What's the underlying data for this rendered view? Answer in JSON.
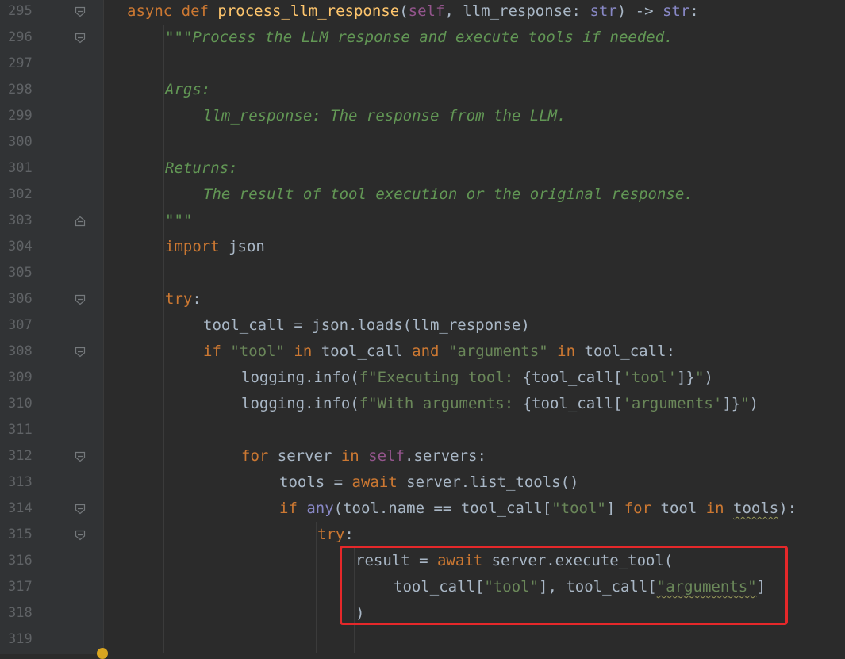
{
  "editor": {
    "lines": [
      {
        "num": "295",
        "indent": 0,
        "fold": "open",
        "tokens": [
          {
            "t": "async ",
            "c": "kw"
          },
          {
            "t": "def ",
            "c": "kw"
          },
          {
            "t": "process_llm_response",
            "c": "fn"
          },
          {
            "t": "(",
            "c": "pl"
          },
          {
            "t": "self",
            "c": "sf"
          },
          {
            "t": ", llm_response: ",
            "c": "pl"
          },
          {
            "t": "str",
            "c": "bi"
          },
          {
            "t": ") -> ",
            "c": "pl"
          },
          {
            "t": "str",
            "c": "bi"
          },
          {
            "t": ":",
            "c": "pl"
          }
        ]
      },
      {
        "num": "296",
        "indent": 1,
        "fold": "open",
        "tokens": [
          {
            "t": "\"\"\"Process the LLM response and execute tools if needed.",
            "c": "doc"
          }
        ]
      },
      {
        "num": "297",
        "indent": 1,
        "fold": "",
        "tokens": []
      },
      {
        "num": "298",
        "indent": 1,
        "fold": "",
        "tokens": [
          {
            "t": "Args:",
            "c": "doc"
          }
        ]
      },
      {
        "num": "299",
        "indent": 2,
        "fold": "",
        "tokens": [
          {
            "t": "llm_response: The response from the LLM.",
            "c": "doc"
          }
        ]
      },
      {
        "num": "300",
        "indent": 1,
        "fold": "",
        "tokens": []
      },
      {
        "num": "301",
        "indent": 1,
        "fold": "",
        "tokens": [
          {
            "t": "Returns:",
            "c": "doc"
          }
        ]
      },
      {
        "num": "302",
        "indent": 2,
        "fold": "",
        "tokens": [
          {
            "t": "The result of tool execution or the original response.",
            "c": "doc"
          }
        ]
      },
      {
        "num": "303",
        "indent": 1,
        "fold": "close",
        "tokens": [
          {
            "t": "\"\"\"",
            "c": "doc"
          }
        ]
      },
      {
        "num": "304",
        "indent": 1,
        "fold": "",
        "tokens": [
          {
            "t": "import ",
            "c": "kw"
          },
          {
            "t": "json",
            "c": "pl"
          }
        ]
      },
      {
        "num": "305",
        "indent": 1,
        "fold": "",
        "tokens": []
      },
      {
        "num": "306",
        "indent": 1,
        "fold": "open",
        "tokens": [
          {
            "t": "try",
            "c": "kw"
          },
          {
            "t": ":",
            "c": "pl"
          }
        ]
      },
      {
        "num": "307",
        "indent": 2,
        "fold": "",
        "tokens": [
          {
            "t": "tool_call = json.loads(llm_response)",
            "c": "pl"
          }
        ]
      },
      {
        "num": "308",
        "indent": 2,
        "fold": "open",
        "tokens": [
          {
            "t": "if ",
            "c": "kw"
          },
          {
            "t": "\"tool\"",
            "c": "st"
          },
          {
            "t": " in ",
            "c": "kw"
          },
          {
            "t": "tool_call ",
            "c": "pl"
          },
          {
            "t": "and ",
            "c": "kw"
          },
          {
            "t": "\"arguments\"",
            "c": "st"
          },
          {
            "t": " in ",
            "c": "kw"
          },
          {
            "t": "tool_call:",
            "c": "pl"
          }
        ]
      },
      {
        "num": "309",
        "indent": 3,
        "fold": "",
        "tokens": [
          {
            "t": "logging.info(",
            "c": "pl"
          },
          {
            "t": "f\"Executing tool: ",
            "c": "st"
          },
          {
            "t": "{tool_call[",
            "c": "pl"
          },
          {
            "t": "'tool'",
            "c": "st"
          },
          {
            "t": "]}",
            "c": "pl"
          },
          {
            "t": "\"",
            "c": "st"
          },
          {
            "t": ")",
            "c": "pl"
          }
        ]
      },
      {
        "num": "310",
        "indent": 3,
        "fold": "",
        "tokens": [
          {
            "t": "logging.info(",
            "c": "pl"
          },
          {
            "t": "f\"With arguments: ",
            "c": "st"
          },
          {
            "t": "{tool_call[",
            "c": "pl"
          },
          {
            "t": "'arguments'",
            "c": "st"
          },
          {
            "t": "]}",
            "c": "pl"
          },
          {
            "t": "\"",
            "c": "st"
          },
          {
            "t": ")",
            "c": "pl"
          }
        ]
      },
      {
        "num": "311",
        "indent": 3,
        "fold": "",
        "tokens": []
      },
      {
        "num": "312",
        "indent": 3,
        "fold": "open",
        "tokens": [
          {
            "t": "for ",
            "c": "kw"
          },
          {
            "t": "server ",
            "c": "pl"
          },
          {
            "t": "in ",
            "c": "kw"
          },
          {
            "t": "self",
            "c": "sf"
          },
          {
            "t": ".servers:",
            "c": "pl"
          }
        ]
      },
      {
        "num": "313",
        "indent": 4,
        "fold": "",
        "tokens": [
          {
            "t": "tools = ",
            "c": "pl"
          },
          {
            "t": "await ",
            "c": "kw"
          },
          {
            "t": "server.list_tools()",
            "c": "pl"
          }
        ]
      },
      {
        "num": "314",
        "indent": 4,
        "fold": "open",
        "tokens": [
          {
            "t": "if ",
            "c": "kw"
          },
          {
            "t": "any",
            "c": "bi"
          },
          {
            "t": "(tool.name == tool_call[",
            "c": "pl"
          },
          {
            "t": "\"tool\"",
            "c": "st"
          },
          {
            "t": "] ",
            "c": "pl"
          },
          {
            "t": "for ",
            "c": "kw"
          },
          {
            "t": "tool ",
            "c": "pl"
          },
          {
            "t": "in ",
            "c": "kw"
          },
          {
            "t": "tools",
            "c": "pl squiggle"
          },
          {
            "t": "):",
            "c": "pl"
          }
        ]
      },
      {
        "num": "315",
        "indent": 5,
        "fold": "open",
        "tokens": [
          {
            "t": "try",
            "c": "kw"
          },
          {
            "t": ":",
            "c": "pl"
          }
        ]
      },
      {
        "num": "316",
        "indent": 6,
        "fold": "",
        "tokens": [
          {
            "t": "result = ",
            "c": "pl"
          },
          {
            "t": "await ",
            "c": "kw"
          },
          {
            "t": "server.execute_tool(",
            "c": "pl"
          }
        ]
      },
      {
        "num": "317",
        "indent": 7,
        "fold": "",
        "tokens": [
          {
            "t": "tool_call[",
            "c": "pl"
          },
          {
            "t": "\"tool\"",
            "c": "st"
          },
          {
            "t": "], ",
            "c": "pl"
          },
          {
            "t": "tool_call[",
            "c": "pl"
          },
          {
            "t": "\"arguments\"",
            "c": "st squiggle"
          },
          {
            "t": "]",
            "c": "pl"
          }
        ]
      },
      {
        "num": "318",
        "indent": 6,
        "fold": "",
        "tokens": [
          {
            "t": ")",
            "c": "pl"
          }
        ]
      },
      {
        "num": "319",
        "indent": 6,
        "fold": "",
        "tokens": []
      }
    ]
  }
}
